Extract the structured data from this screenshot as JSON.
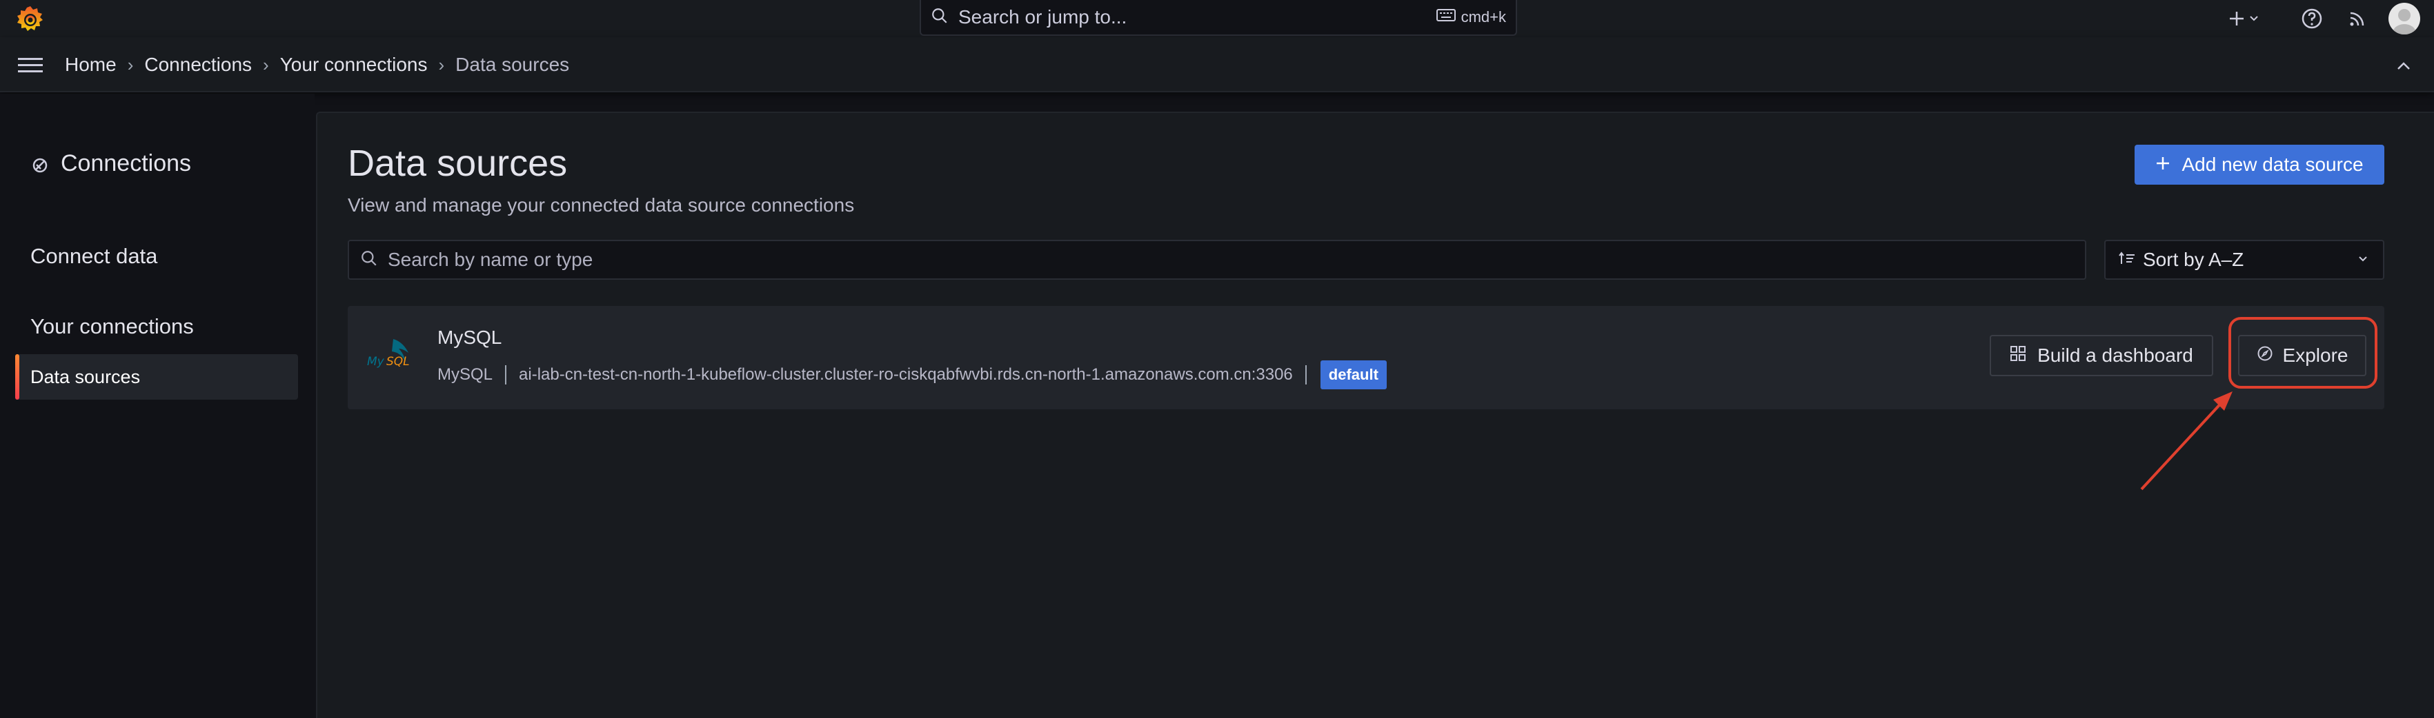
{
  "topbar": {
    "search_placeholder": "Search or jump to...",
    "search_shortcut": "cmd+k",
    "icons": [
      "grafana-logo-icon",
      "search-icon",
      "keyboard-icon",
      "plus-icon",
      "chevron-down-icon",
      "help-icon",
      "news-rss-icon",
      "user-avatar"
    ]
  },
  "navbar": {
    "breadcrumbs": [
      {
        "label": "Home"
      },
      {
        "label": "Connections"
      },
      {
        "label": "Your connections"
      },
      {
        "label": "Data sources"
      }
    ]
  },
  "sidebar": {
    "title": "Connections",
    "sections": [
      {
        "label": "Connect data"
      },
      {
        "label": "Your connections"
      }
    ],
    "active_item": "Data sources"
  },
  "main": {
    "title": "Data sources",
    "subtitle": "View and manage your connected data source connections",
    "add_button": "Add new data source",
    "filter_placeholder": "Search by name or type",
    "sort_label": "Sort by A–Z",
    "datasources": [
      {
        "name": "MySQL",
        "type": "MySQL",
        "url": "ai-lab-cn-test-cn-north-1-kubeflow-cluster.cluster-ro-ciskqabfwvbi.rds.cn-north-1.amazonaws.com.cn:3306",
        "badge": "default",
        "build_button": "Build a dashboard",
        "explore_button": "Explore"
      }
    ]
  },
  "colors": {
    "accent_primary": "#3d71d9",
    "annotation_red": "#e0402e",
    "active_indicator": "#f05a28"
  }
}
